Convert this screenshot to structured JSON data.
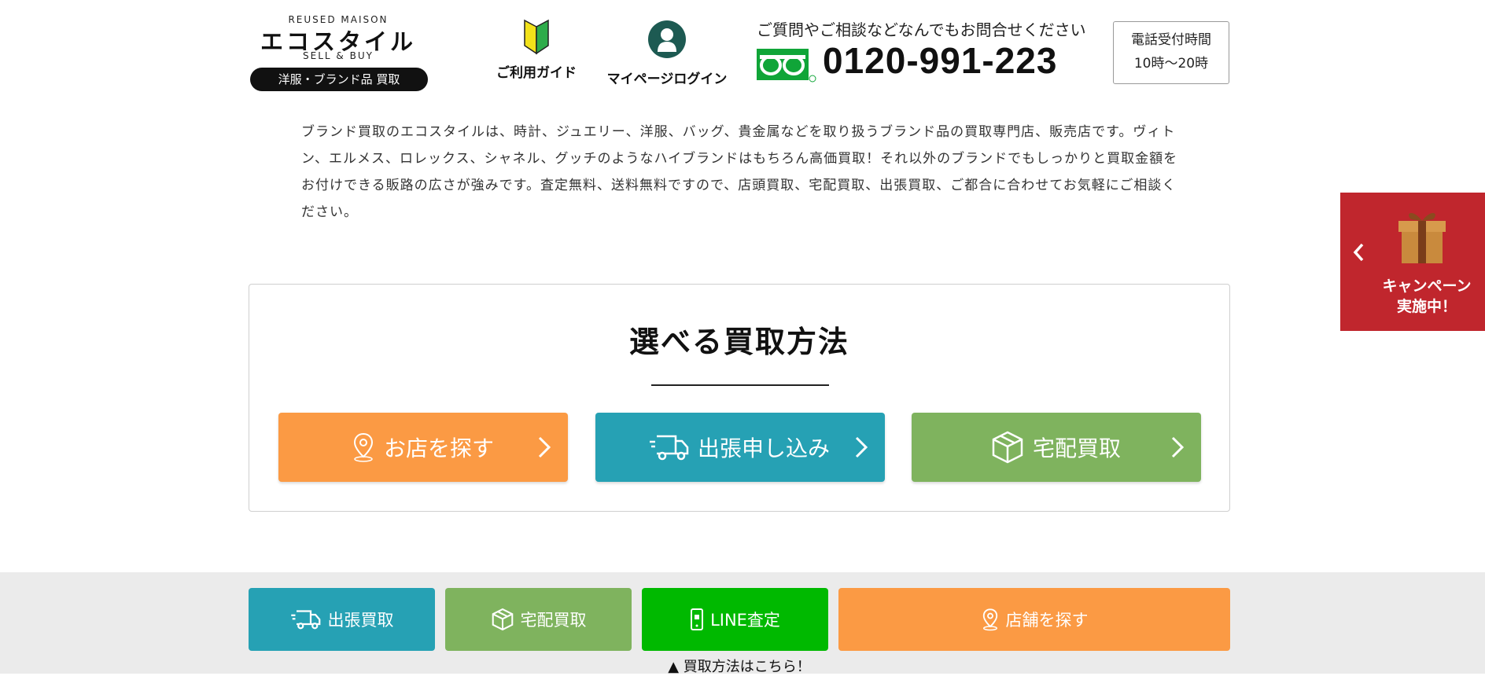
{
  "header": {
    "logo": {
      "top_text": "REUSED MAISON",
      "name": "エコスタイル",
      "bottom_text": "SELL & BUY",
      "pill": "洋服・ブランド品 買取"
    },
    "guide_label": "ご利用ガイド",
    "mypage_label": "マイページログイン",
    "contact_text": "ご質問やご相談などなんでもお問合せください",
    "phone": "0120-991-223",
    "hours_title": "電話受付時間",
    "hours_value": "10時〜20時"
  },
  "description": "ブランド買取のエコスタイルは、時計、ジュエリー、洋服、バッグ、貴金属などを取り扱うブランド品の買取専門店、販売店です。ヴィトン、エルメス、ロレックス、シャネル、グッチのようなハイブランドはもちろん高価買取！それ以外のブランドでもしっかりと買取金額をお付けできる販路の広さが強みです。査定無料、送料無料ですので、店頭買取、宅配買取、出張買取、ご都合に合わせてお気軽にご相談ください。",
  "methods": {
    "title": "選べる買取方法",
    "buttons": [
      {
        "label": "お店を探す",
        "icon": "map-pin-icon",
        "color": "#fb9a44"
      },
      {
        "label": "出張申し込み",
        "icon": "truck-icon",
        "color": "#26a1b4"
      },
      {
        "label": "宅配買取",
        "icon": "box-icon",
        "color": "#7fb35e"
      }
    ]
  },
  "campaign": {
    "line1": "キャンペーン",
    "line2": "実施中！",
    "color": "#c0262d"
  },
  "bottom_bar": {
    "buttons": [
      {
        "label": "出張買取",
        "icon": "truck-icon",
        "color": "#26a1b4"
      },
      {
        "label": "宅配買取",
        "icon": "box-icon",
        "color": "#7fb35e"
      },
      {
        "label": "LINE査定",
        "icon": "phone-icon",
        "color": "#00b900"
      },
      {
        "label": "店舗を探す",
        "icon": "map-pin-icon",
        "color": "#fb9a44"
      }
    ],
    "note": "▲ 買取方法はこちら！"
  }
}
